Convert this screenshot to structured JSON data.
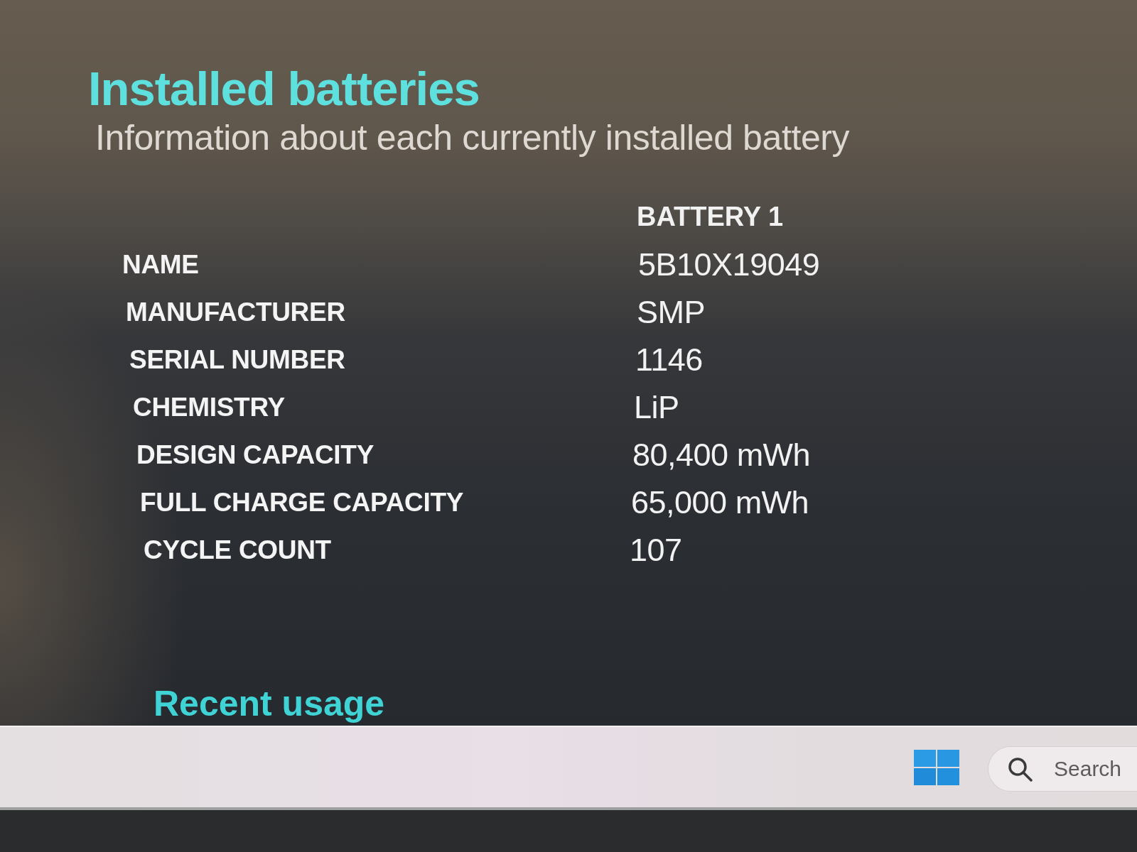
{
  "report": {
    "title": "Installed batteries",
    "subtitle": "Information about each currently installed battery"
  },
  "table": {
    "columns": [
      {
        "label": "BATTERY 1"
      }
    ],
    "rows": [
      {
        "label": "NAME",
        "values": [
          "5B10X19049"
        ]
      },
      {
        "label": "MANUFACTURER",
        "values": [
          "SMP"
        ]
      },
      {
        "label": "SERIAL NUMBER",
        "values": [
          "1146"
        ]
      },
      {
        "label": "CHEMISTRY",
        "values": [
          "LiP"
        ]
      },
      {
        "label": "DESIGN CAPACITY",
        "values": [
          "80,400 mWh"
        ]
      },
      {
        "label": "FULL CHARGE CAPACITY",
        "values": [
          "65,000 mWh"
        ]
      },
      {
        "label": "CYCLE COUNT",
        "values": [
          "107"
        ]
      }
    ]
  },
  "next_section": {
    "title": "Recent usage"
  },
  "taskbar": {
    "search_button": {
      "label": "Search"
    }
  }
}
